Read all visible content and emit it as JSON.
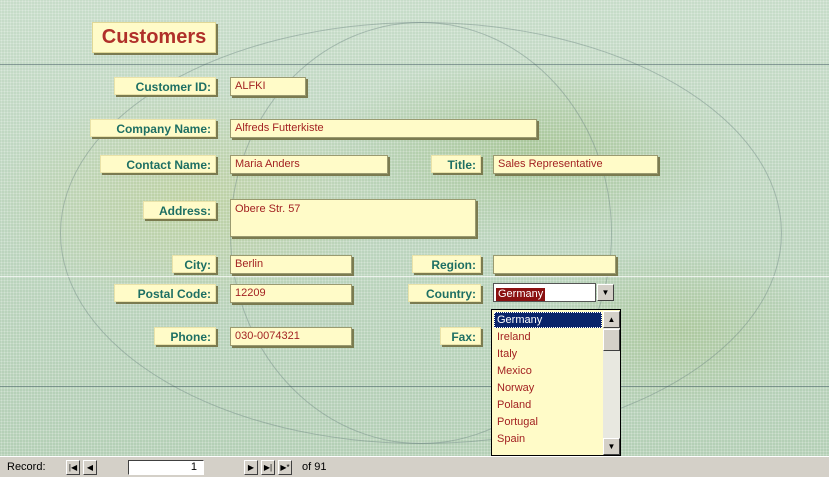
{
  "form": {
    "title": "Customers",
    "labels": {
      "customer_id": "Customer ID:",
      "company_name": "Company Name:",
      "contact_name": "Contact Name:",
      "title": "Title:",
      "address": "Address:",
      "city": "City:",
      "region": "Region:",
      "postal_code": "Postal Code:",
      "country": "Country:",
      "phone": "Phone:",
      "fax": "Fax:"
    },
    "values": {
      "customer_id": "ALFKI",
      "company_name": "Alfreds Futterkiste",
      "contact_name": "Maria Anders",
      "title": "Sales Representative",
      "address": "Obere Str. 57",
      "city": "Berlin",
      "region": "",
      "postal_code": "12209",
      "country": "Germany",
      "phone": "030-0074321",
      "fax": ""
    },
    "country_options": [
      "Germany",
      "Ireland",
      "Italy",
      "Mexico",
      "Norway",
      "Poland",
      "Portugal",
      "Spain"
    ],
    "selected_country": "Germany"
  },
  "navigation": {
    "record_label": "Record:",
    "current_record": "1",
    "of_label": "of",
    "total_records": "91",
    "buttons": {
      "first": "|◀",
      "prev": "◀",
      "next": "▶",
      "last": "▶|",
      "new": "▶*"
    }
  },
  "colors": {
    "label_text": "#1d6f63",
    "field_text": "#a32222",
    "field_background": "#fffbc8",
    "selection": "#0a246a"
  }
}
